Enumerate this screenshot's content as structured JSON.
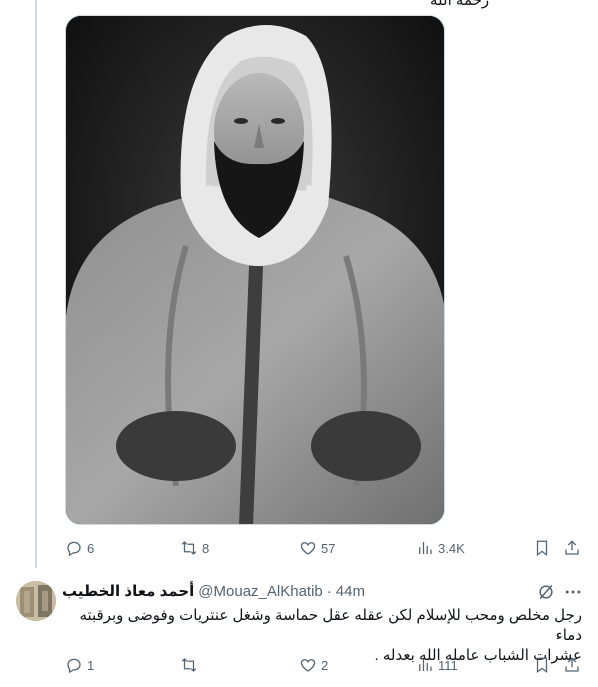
{
  "top_clip_text": "رحمه الله",
  "main_tweet": {
    "media_alt": "Black and white portrait photograph of a bearded man wearing a white head covering and a traditional robe",
    "actions": {
      "reply_count": "6",
      "retweet_count": "8",
      "like_count": "57",
      "views_count": "3.4K"
    }
  },
  "reply": {
    "author_name": "أحمد معاذ الخطيب",
    "handle": "@Mouaz_AlKhatib",
    "separator": "·",
    "time": "44m",
    "text_line1": "رجل مخلص ومحب للإسلام لكن عقله عقل حماسة وشغل عنتريات وفوضى وبرقبته دماء",
    "text_line2": "عشرات الشباب عامله الله بعدله .",
    "actions": {
      "reply_count": "1",
      "retweet_count": "",
      "like_count": "2",
      "views_count": "111"
    }
  },
  "colors": {
    "text_primary": "#0f1419",
    "text_secondary": "#536471",
    "border": "#cfd9de"
  }
}
